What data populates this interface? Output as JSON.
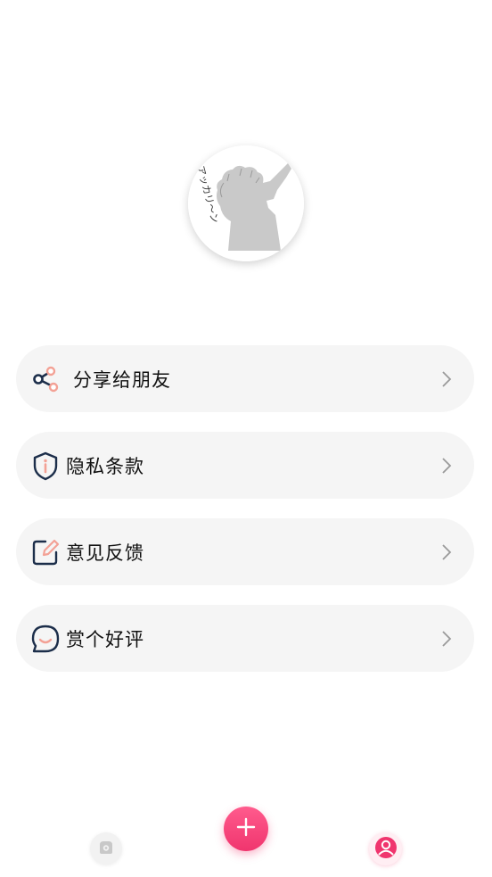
{
  "profile": {
    "avatar_icon": "anime-silhouette-avatar",
    "avatar_caption": "アッカリ〜ン"
  },
  "menu": {
    "items": [
      {
        "label": "分享给朋友",
        "icon": "share-icon"
      },
      {
        "label": "隐私条款",
        "icon": "shield-info-icon"
      },
      {
        "label": "意见反馈",
        "icon": "edit-icon"
      },
      {
        "label": "赏个好评",
        "icon": "chat-smile-icon"
      }
    ]
  },
  "bottom_nav": {
    "items": [
      {
        "icon": "home-icon",
        "active": false
      },
      {
        "icon": "plus-icon",
        "active": false
      },
      {
        "icon": "profile-icon",
        "active": true
      }
    ]
  },
  "colors": {
    "accent_pink": "#f0356e",
    "icon_navy": "#1c2e4a",
    "icon_salmon": "#f3a195",
    "card_bg": "#f5f5f5"
  }
}
